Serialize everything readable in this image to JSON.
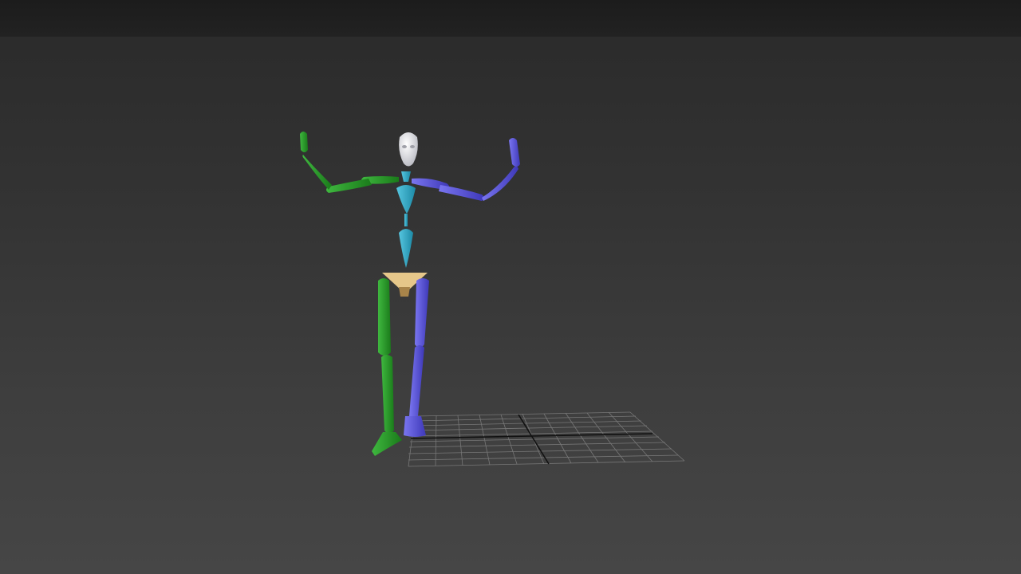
{
  "viewport": {
    "background_top": "#222222",
    "background_bottom": "#464646"
  },
  "biped": {
    "colors": {
      "left_limbs": "#1f8f1f",
      "right_limbs": "#5a55d8",
      "spine": "#2fa7c4",
      "pelvis": "#e6c78a",
      "head": "#e8e8ec"
    }
  },
  "grid": {
    "color": "#8a8a8a",
    "axis_color": "#111111"
  }
}
